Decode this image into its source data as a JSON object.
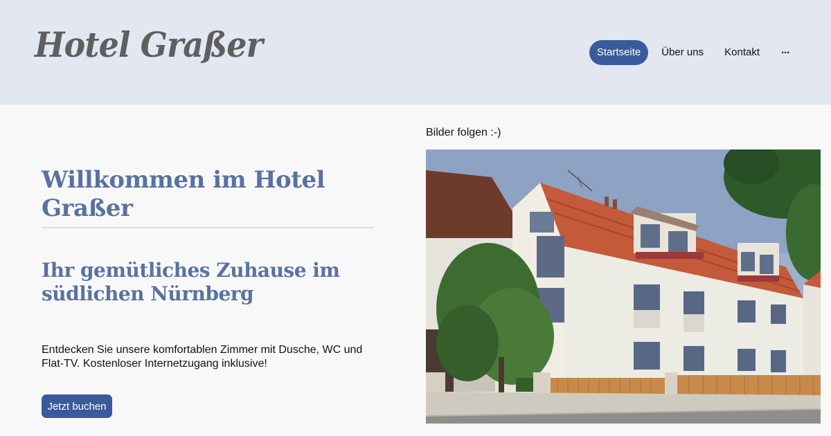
{
  "header": {
    "logo": "Hotel Graßer",
    "nav": [
      {
        "label": "Startseite",
        "active": true
      },
      {
        "label": "Über uns",
        "active": false
      },
      {
        "label": "Kontakt",
        "active": false
      }
    ],
    "more_icon": "ellipsis-icon"
  },
  "main": {
    "title": "Willkommen im Hotel Graßer",
    "subtitle": "Ihr gemütliches Zuhause im südlichen Nürnberg",
    "description": "Entdecken Sie unsere komfortablen Zimmer mit Dusche, WC und Flat-TV. Kostenloser Internetzugang inklusive!",
    "cta_label": "Jetzt buchen",
    "photo_caption": "Bilder folgen :-)"
  },
  "colors": {
    "header_bg": "#e3e7f1",
    "accent": "#3a5a9c",
    "heading": "#5872a0",
    "page_bg": "#f8f8f9"
  }
}
